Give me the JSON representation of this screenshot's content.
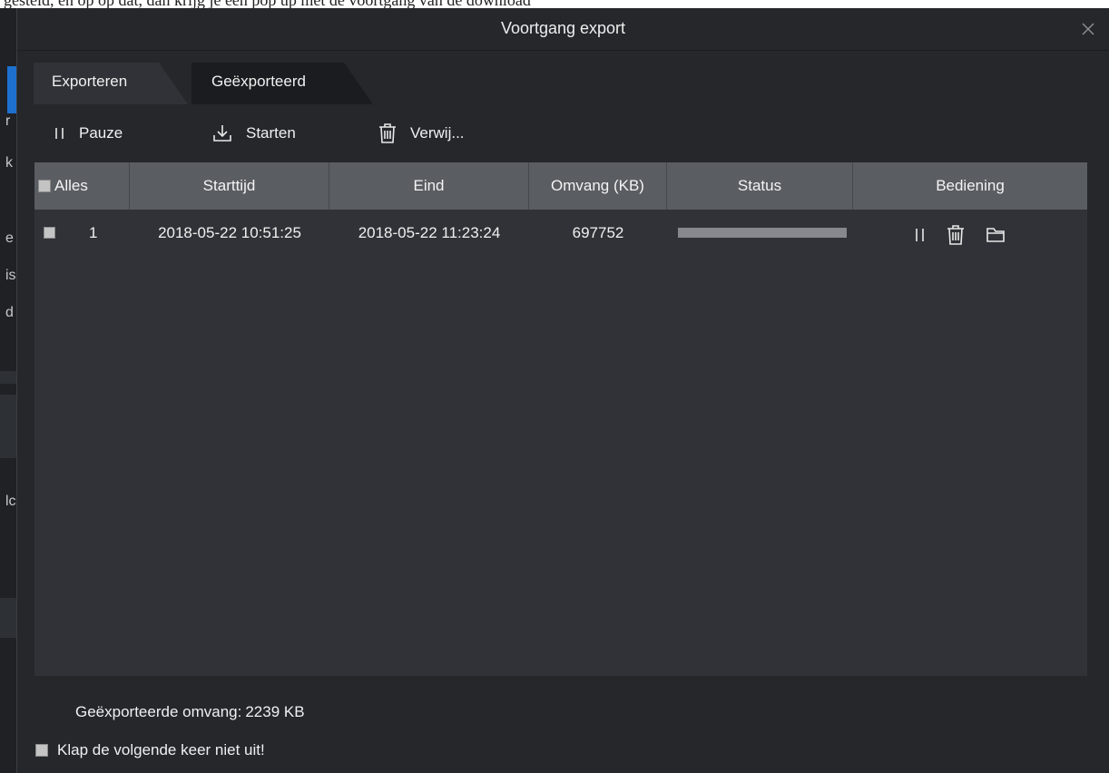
{
  "dialog": {
    "title": "Voortgang export"
  },
  "tabs": [
    {
      "label": "Exporteren",
      "active": false
    },
    {
      "label": "Geëxporteerd",
      "active": true
    }
  ],
  "toolbar": {
    "pause_label": "Pauze",
    "start_label": "Starten",
    "delete_label": "Verwij..."
  },
  "table": {
    "select_all_label": "Alles",
    "columns": [
      "Starttijd",
      "Eind",
      "Omvang (KB)",
      "Status",
      "Bediening"
    ],
    "rows": [
      {
        "index": "1",
        "start": "2018-05-22 10:51:25",
        "end": "2018-05-22 11:23:24",
        "size": "697752",
        "progress_percent": 100
      }
    ]
  },
  "footer": {
    "size_label": "Geëxporteerde omvang:",
    "size_value": "2239 KB",
    "dont_expand_label": "Klap de volgende keer niet uit!"
  },
  "background": {
    "doc_text": "gesteld, en op op dat, dan krijg je een pop up met de voortgang van de download",
    "side_letters": [
      "r",
      "k",
      "e",
      "is",
      "d",
      "lc"
    ]
  },
  "icons": {
    "close": "close-icon",
    "pause": "pause-icon",
    "start": "download-icon",
    "delete": "trash-icon",
    "folder": "folder-icon"
  }
}
